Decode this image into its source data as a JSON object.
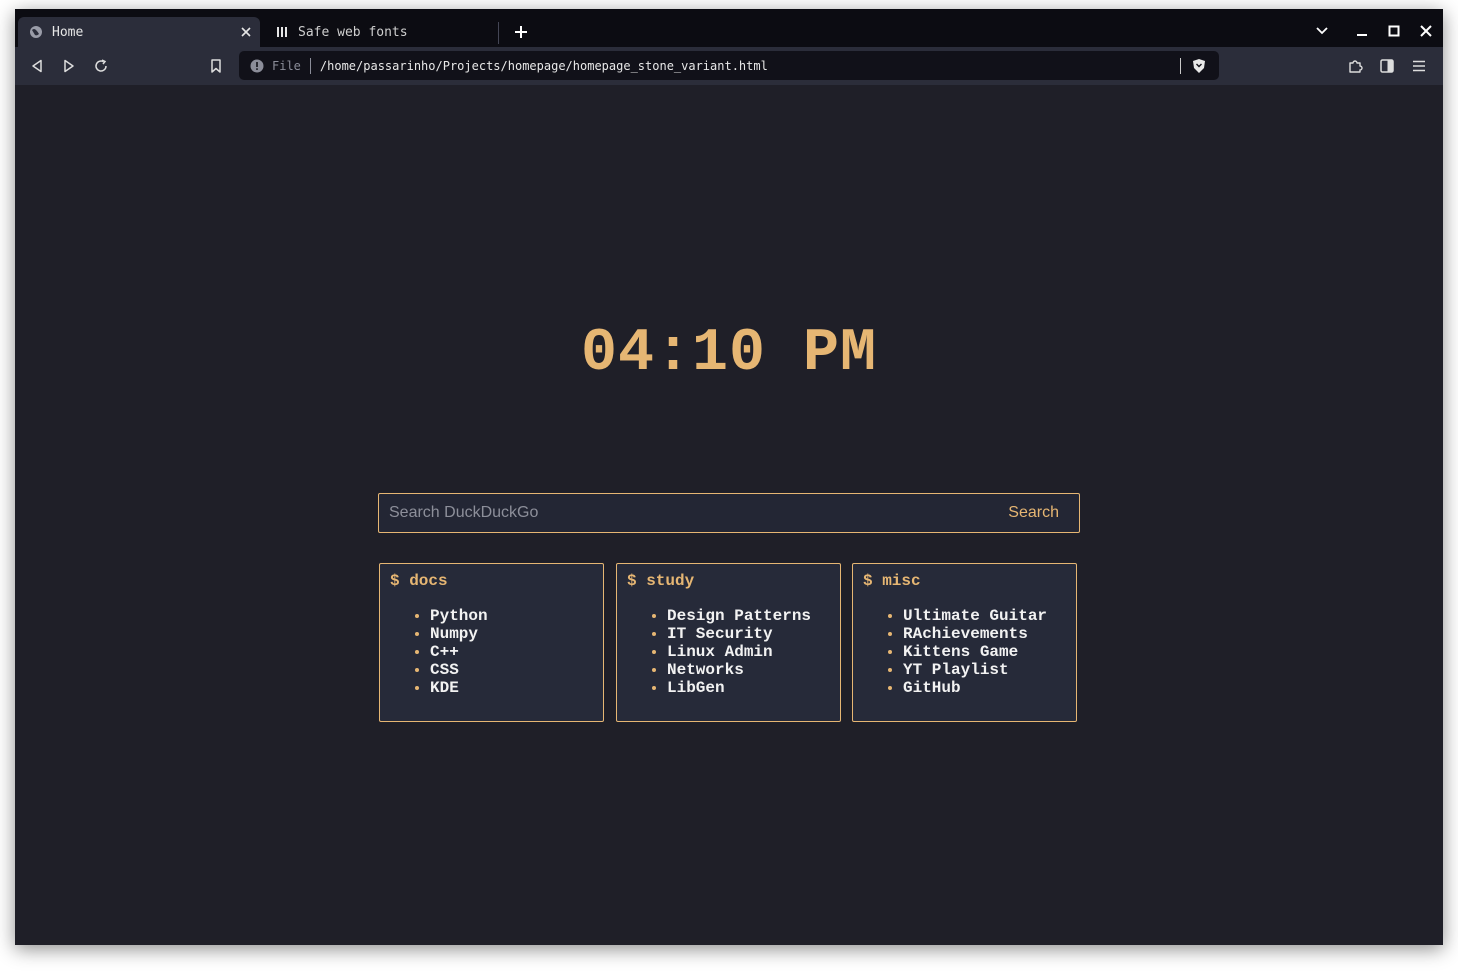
{
  "browser": {
    "tabs": [
      {
        "title": "Home",
        "icon": "globe-icon",
        "active": true
      },
      {
        "title": "Safe web fonts",
        "icon": "site-favicon-icon",
        "active": false
      }
    ],
    "address": {
      "scheme_label": "File",
      "url": "/home/passarinho/Projects/homepage/homepage_stone_variant.html"
    }
  },
  "page": {
    "clock": "04:10 PM",
    "search": {
      "placeholder": "Search DuckDuckGo",
      "button_label": "Search"
    },
    "cards": [
      {
        "title": "$ docs",
        "links": [
          "Python",
          "Numpy",
          "C++",
          "CSS",
          "KDE"
        ]
      },
      {
        "title": "$ study",
        "links": [
          "Design Patterns",
          "IT Security",
          "Linux Admin",
          "Networks",
          "LibGen"
        ]
      },
      {
        "title": "$ misc",
        "links": [
          "Ultimate Guitar",
          "RAchievements",
          "Kittens Game",
          "YT Playlist",
          "GitHub"
        ]
      }
    ]
  },
  "colors": {
    "accent": "#e6b673",
    "page_bg": "#1f1f28",
    "card_bg": "#262a39",
    "toolbar_bg": "#2b2d3a",
    "tabstrip_bg": "#0c0c12"
  }
}
